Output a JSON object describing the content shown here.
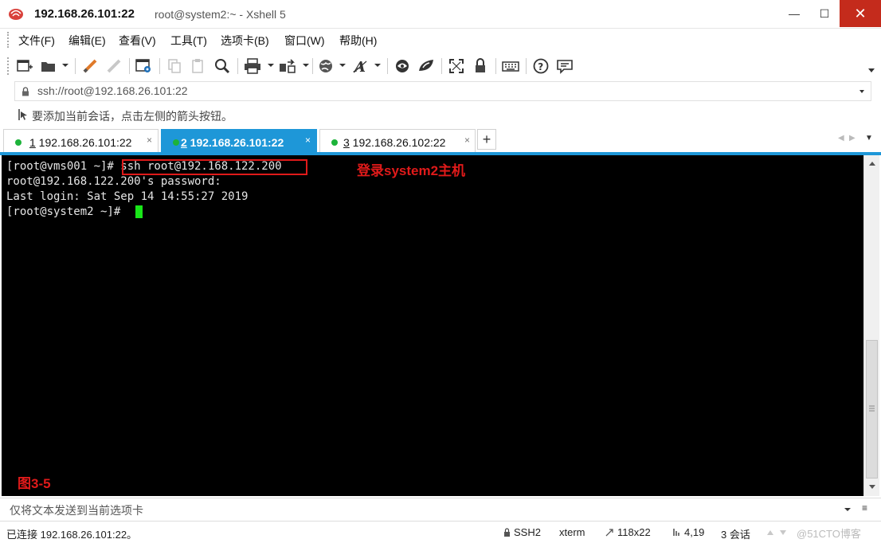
{
  "window": {
    "title_main": "192.168.26.101:22",
    "title_sub": "root@system2:~ - Xshell 5",
    "minimize_label": "—",
    "maximize_label": "☐",
    "close_label": "✕"
  },
  "menu": {
    "items": [
      {
        "label": "文件(F)"
      },
      {
        "label": "编辑(E)"
      },
      {
        "label": "查看(V)"
      },
      {
        "label": "工具(T)"
      },
      {
        "label": "选项卡(B)"
      },
      {
        "label": "窗口(W)"
      },
      {
        "label": "帮助(H)"
      }
    ]
  },
  "toolbar": {
    "icons": [
      "new-session-icon",
      "open-folder-icon",
      "reconnect-icon",
      "disconnect-icon",
      "properties-icon",
      "copy-icon",
      "paste-icon",
      "find-icon",
      "print-icon",
      "transfer-icon",
      "globe-icon",
      "font-icon",
      "xftp-icon",
      "xmanager-icon",
      "fullscreen-icon",
      "lock-icon",
      "keyboard-icon",
      "help-icon",
      "chat-icon"
    ]
  },
  "address": {
    "value": "ssh://root@192.168.26.101:22"
  },
  "hint": {
    "text": "要添加当前会话，点击左侧的箭头按钮。"
  },
  "tabs": [
    {
      "num": "1",
      "label": " 192.168.26.101:22",
      "close": "×",
      "active": false
    },
    {
      "num": "2",
      "label": " 192.168.26.101:22",
      "close": "×",
      "active": true
    },
    {
      "num": "3",
      "label": " 192.168.26.102:22",
      "close": "×",
      "active": false
    }
  ],
  "tab_add_label": "+",
  "tab_nav": {
    "prev": "◀",
    "next": "▶",
    "menu": "▼"
  },
  "terminal": {
    "lines": [
      "[root@vms001 ~]# ssh root@192.168.122.200",
      "root@192.168.122.200's password:",
      "Last login: Sat Sep 14 14:55:27 2019",
      "[root@system2 ~]# "
    ],
    "annotation": "登录system2主机",
    "figure_label": "图3-5",
    "cursor_color": "#19e619",
    "highlight_color": "#e01a1a"
  },
  "sendbar": {
    "placeholder": "仅将文本发送到当前选项卡"
  },
  "status": {
    "connection": "已连接 192.168.26.101:22。",
    "protocol": "SSH2",
    "terminal_type": "xterm",
    "size": "118x22",
    "cursor_pos": "4,19",
    "sessions": "3 会话",
    "watermark": "@51CTO博客"
  },
  "colors": {
    "accent": "#1e97d8",
    "close_button": "#c42b1c",
    "online_dot": "#1db33a"
  }
}
